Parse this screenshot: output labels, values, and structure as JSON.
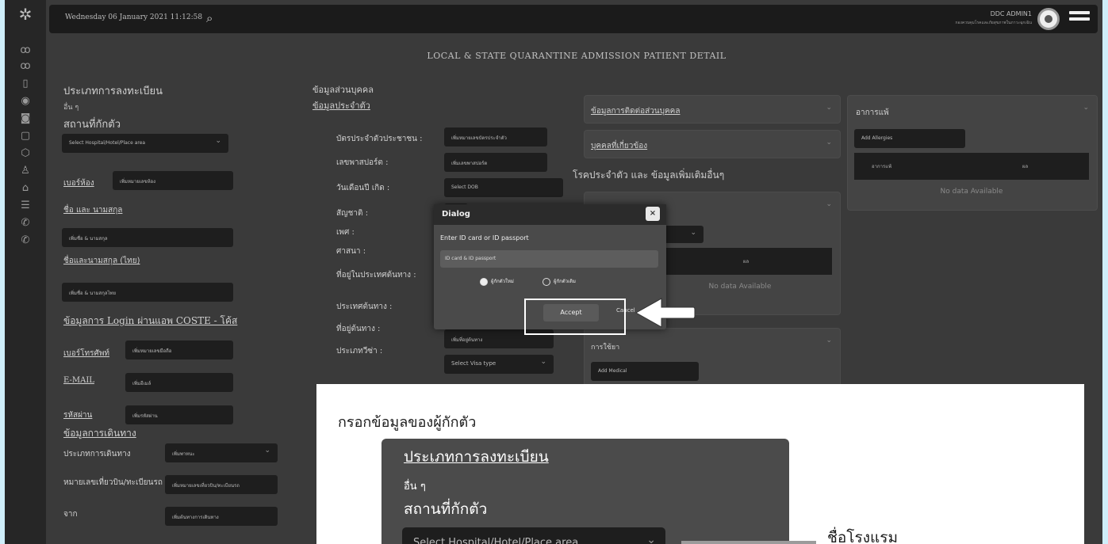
{
  "topbar": {
    "datetime": "Wednesday 06 January 2021 11:12:58",
    "admin_name": "DDC ADMIN1",
    "admin_org": "กองควบคุมโรคและภัยสุขภาพในภาวะฉุกเฉิน"
  },
  "page_title": "LOCAL & STATE QUARANTINE ADMISSION PATIENT DETAIL",
  "left": {
    "reg_type_title": "ประเภทการลงทะเบียน",
    "reg_type_value": "อื่น ๆ",
    "place_title": "สถานที่กักตัว",
    "place_select": "Select Hospital/Hotel/Place area",
    "room_label": "เบอร์ห้อง",
    "room_value": "เพิ่มหมายเลขห้อง",
    "name_en_label": "ชื่อ และ นามสกุล",
    "name_en_value": "เพิ่มชื่อ & นามสกุล",
    "name_th_label": "ชื่อและนามสกุล (ไทย)",
    "name_th_value": "เพิ่มชื่อ & นามสกุลไทย",
    "login_title": "ข้อมูลการ Login ผ่านแอพ COSTE - โค้ส",
    "phone_label": "เบอร์โทรศัพท์",
    "phone_value": "เพิ่มหมายเลขมือถือ",
    "email_label": "E-MAIL",
    "email_value": "เพิ่มอีเมล์",
    "password_label": "รหัสผ่าน",
    "password_value": "เพิ่มรหัสผ่าน",
    "travel_title": "ข้อมูลการเดินทาง",
    "travel_type_label": "ประเภทการเดินทาง",
    "travel_type_value": "เพิ่มพาหนะ",
    "flight_label": "หมายเลขเที่ยวบิน/ทะเบียนรถ",
    "flight_value": "เพิ่มหมายเลขเที่ยวบิน/ทะเบียนรถ",
    "from_label": "จาก",
    "from_value": "เพิ่มต้นทางการเดินทาง"
  },
  "middle": {
    "personal_title": "ข้อมูลส่วนบุคคล",
    "id_section_title": "ข้อมูลประจำตัว",
    "id_card_label": "บัตรประจำตัวประชาชน :",
    "id_card_value": "เพิ่มหมายเลขบัตรประจำตัว",
    "passport_label": "เลขพาสปอร์ต :",
    "passport_value": "เพิ่มเลขพาสปอร์ต",
    "dob_label": "วันเดือนปี เกิด :",
    "dob_value": "Select DOB",
    "nationality_label": "สัญชาติ :",
    "sex_label": "เพศ :",
    "religion_label": "ศาสนา :",
    "address_origin_label": "ที่อยู่ในประเทศต้นทาง :",
    "origin_country_label": "ประเทศต้นทาง :",
    "origin_address_label": "ที่อยู่ต้นทาง :",
    "origin_address_value": "เพิ่มที่อยู่ต้นทาง",
    "visa_label": "ประเภทวีซ่า :",
    "visa_value": "Select Visa type"
  },
  "right": {
    "contact_title": "ข้อมูลการติดต่อส่วนบุคคล",
    "related_title": "บุคคลที่เกี่ยวข้อง",
    "disease_title": "โรคประจำตัว และ ข้อมูลเพิ่มเติมอื่นๆ",
    "disease_col": "ผล",
    "no_data": "No data Available",
    "medication_title": "การใช้ยา",
    "medication_add": "Add Medical",
    "allergy_title": "อาการแพ้",
    "allergy_add": "Add Allergies",
    "allergy_col1": "อาการแพ้",
    "allergy_col2": "ผล"
  },
  "dialog": {
    "title": "Dialog",
    "close": "×",
    "prompt": "Enter ID card or ID passport",
    "input_placeholder": "ID card & ID passport",
    "radio_new": "ผู้กักตัวใหม่",
    "radio_old": "ผู้กักตัวเดิม",
    "accept": "Accept",
    "cancel": "Cancel"
  },
  "callout": {
    "heading": "กรอกข้อมูลของผู้กักตัว",
    "reg_type_title": "ประเภทการลงทะเบียน",
    "reg_type_value": "อื่น ๆ",
    "place_title": "สถานที่กักตัว",
    "place_select": "Select Hospital/Hotel/Place area",
    "hotel_label": "ชื่อโรงแรม"
  },
  "colors": {
    "background": "#cfeefa",
    "screen": "#3a3a3a",
    "topbar": "#1b1b1b"
  }
}
